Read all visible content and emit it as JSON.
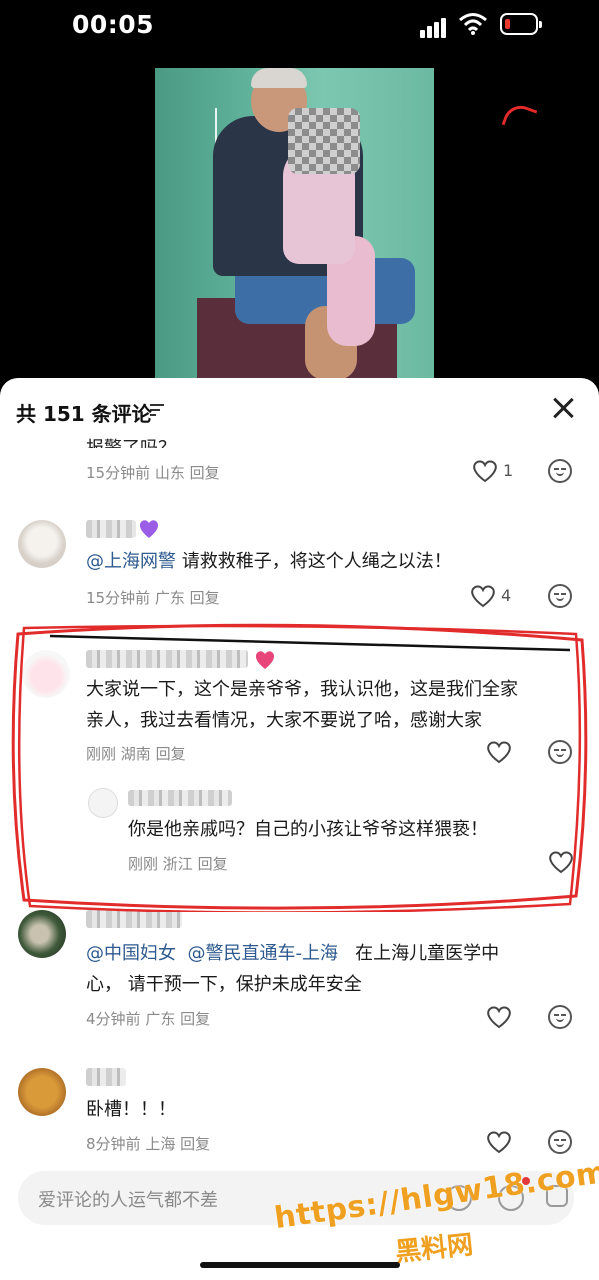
{
  "status_bar": {
    "time": "00:05"
  },
  "comments_panel": {
    "title": "共 151 条评论",
    "input_placeholder": "爱评论的人运气都不差"
  },
  "comments": [
    {
      "partial_text": "报警了吗？",
      "time": "15分钟前",
      "location": "山东",
      "reply_label": "回复",
      "likes": "1"
    },
    {
      "mention": "@上海网警",
      "text": " 请救救稚子，将这个人绳之以法！",
      "time": "15分钟前",
      "location": "广东",
      "reply_label": "回复",
      "likes": "4"
    },
    {
      "text_line1": "大家说一下，这个是亲爷爷，我认识他，这是我们全家",
      "text_line2": "亲人，我过去看情况，大家不要说了哈，感谢大家",
      "time": "刚刚",
      "location": "湖南",
      "reply_label": "回复",
      "reply": {
        "text": "你是他亲戚吗？自己的小孩让爷爷这样猥亵！",
        "time": "刚刚",
        "location": "浙江",
        "reply_label": "回复"
      }
    },
    {
      "mention1": "@中国妇女",
      "mention2": "@警民直通车-上海",
      "text_tail": "在上海儿童医学中",
      "text_line2": "心，  请干预一下，保护未成年安全",
      "time": "4分钟前",
      "location": "广东",
      "reply_label": "回复"
    },
    {
      "text": "卧槽！！！",
      "time": "8分钟前",
      "location": "上海",
      "reply_label": "回复"
    }
  ],
  "watermark": {
    "url": "https://hlgw18.com",
    "name": "黑料网"
  },
  "colors": {
    "accent_mention": "#2e5a8f",
    "annotation": "#e22c2c",
    "watermark": "#f0a020"
  }
}
